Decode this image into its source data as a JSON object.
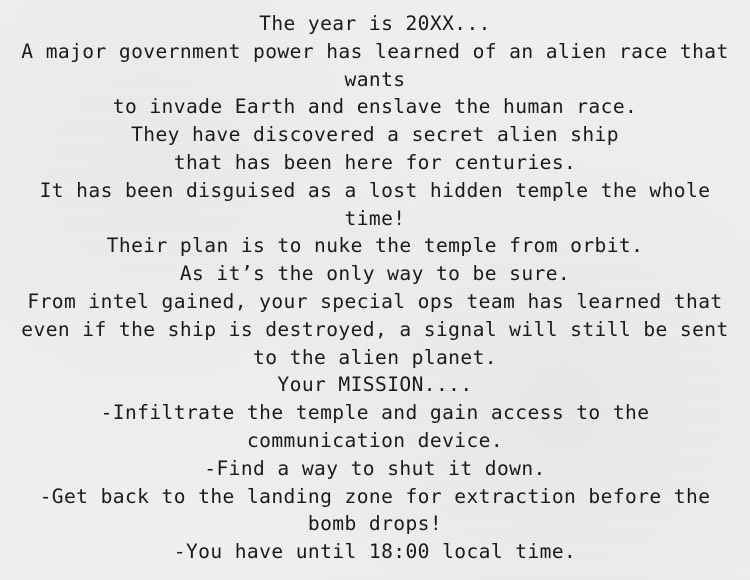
{
  "briefing": {
    "lines": [
      "The year is 20XX...",
      "A major government power has learned of an alien race that",
      "wants",
      "to invade Earth and enslave the human race.",
      "They have discovered a secret alien ship",
      "that has been here for centuries.",
      "It has been disguised as a lost hidden temple the whole",
      "time!",
      "Their plan is to nuke the temple from orbit.",
      "As it’s the only way to be sure.",
      "From intel gained, your special ops team has learned that",
      "even if the ship is destroyed, a signal will still be sent",
      "to the alien planet.",
      "Your MISSION....",
      "-Infiltrate the temple and gain access to the",
      "communication device.",
      "-Find a way to shut it down.",
      "-Get back to the landing zone for extraction before the",
      "bomb drops!",
      "-You have until 18:00 local time."
    ]
  },
  "colors": {
    "background": "#efefef",
    "text": "#1a1a1a"
  }
}
